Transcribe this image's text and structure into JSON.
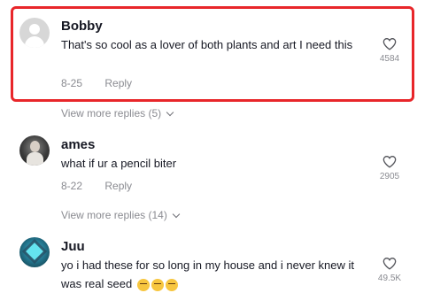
{
  "comments": [
    {
      "username": "Bobby",
      "text": "That's so cool as a lover of both plants and art I need this",
      "date": "8-25",
      "reply_label": "Reply",
      "likes": "4584",
      "highlighted": true,
      "view_more_replies": "View more replies (5)",
      "avatar": "default-avatar"
    },
    {
      "username": "ames",
      "text": "what if ur a pencil biter",
      "date": "8-22",
      "reply_label": "Reply",
      "likes": "2905",
      "view_more_replies": "View more replies (14)",
      "avatar": "profile-photo"
    },
    {
      "username": "Juu",
      "text": "yo i had these for so long in my house and i never knew it was real seed",
      "emojis": [
        "crying-laughing-emoji",
        "crying-laughing-emoji",
        "crying-laughing-emoji"
      ],
      "likes": "49.5K",
      "avatar": "profile-photo"
    }
  ],
  "colors": {
    "highlight_border": "#e8262a",
    "meta_text": "#8a8b91",
    "primary_text": "#161823"
  },
  "icons": {
    "like": "heart-outline-icon",
    "expand": "chevron-down-icon"
  }
}
